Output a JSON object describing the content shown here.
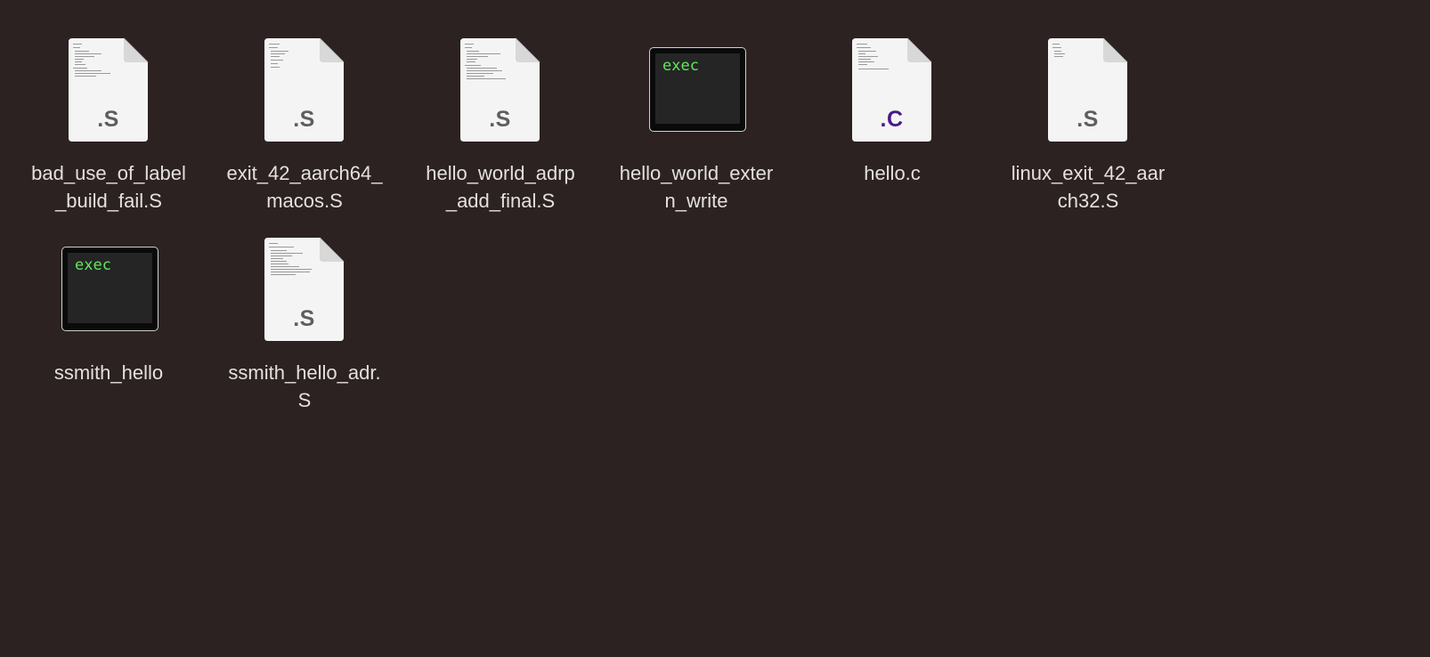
{
  "window": {
    "background": "#2b2221"
  },
  "files": [
    {
      "name_lines": [
        "bad_use_of_label",
        "_build_fail.S"
      ],
      "icon": "document-icon",
      "ext": ".S",
      "ext_color": "#5e5e5e"
    },
    {
      "name_lines": [
        "exit_42_aarch64_",
        "macos.S"
      ],
      "icon": "document-icon",
      "ext": ".S",
      "ext_color": "#5e5e5e"
    },
    {
      "name_lines": [
        "hello_world_adrp",
        "_add_final.S"
      ],
      "icon": "document-icon",
      "ext": ".S",
      "ext_color": "#5e5e5e"
    },
    {
      "name_lines": [
        "hello_world_exter",
        "n_write"
      ],
      "icon": "exec-icon",
      "exec_text": "exec"
    },
    {
      "name_lines": [
        "hello.c"
      ],
      "icon": "document-icon",
      "ext": ".C",
      "ext_color": "#4a1a8a"
    },
    {
      "name_lines": [
        "linux_exit_42_aar",
        "ch32.S"
      ],
      "icon": "document-icon",
      "ext": ".S",
      "ext_color": "#5e5e5e"
    },
    {
      "name_lines": [
        "ssmith_hello"
      ],
      "icon": "exec-icon",
      "exec_text": "exec"
    },
    {
      "name_lines": [
        "ssmith_hello_adr.",
        "S"
      ],
      "icon": "document-icon",
      "ext": ".S",
      "ext_color": "#5e5e5e"
    }
  ]
}
